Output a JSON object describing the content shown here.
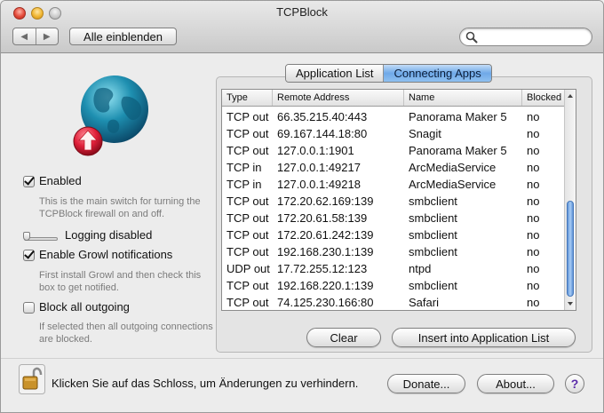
{
  "window": {
    "title": "TCPBlock"
  },
  "toolbar": {
    "back_icon": "chevron-left-icon",
    "forward_icon": "chevron-right-icon",
    "show_all_label": "Alle einblenden",
    "search_placeholder": "",
    "search_icon": "search-icon"
  },
  "options": {
    "enabled": {
      "label": "Enabled",
      "checked": true,
      "help": "This is the main switch for turning the TCPBlock firewall on and off."
    },
    "logging": {
      "label": "Logging disabled",
      "level": 0
    },
    "growl": {
      "label": "Enable Growl notifications",
      "checked": true,
      "help": "First install Growl and then check this box to get notified."
    },
    "block_outgoing": {
      "label": "Block all outgoing",
      "checked": false,
      "help": "If selected then all outgoing connections are blocked."
    }
  },
  "tabs": [
    {
      "label": "Application List",
      "active": false
    },
    {
      "label": "Connecting Apps",
      "active": true
    }
  ],
  "table": {
    "headers": [
      "Type",
      "Remote Address",
      "Name",
      "Blocked"
    ],
    "rows": [
      [
        "TCP out",
        "66.35.215.40:443",
        "Panorama Maker 5",
        "no"
      ],
      [
        "TCP out",
        "69.167.144.18:80",
        "Snagit",
        "no"
      ],
      [
        "TCP out",
        "127.0.0.1:1901",
        "Panorama Maker 5",
        "no"
      ],
      [
        "TCP in",
        "127.0.0.1:49217",
        "ArcMediaService",
        "no"
      ],
      [
        "TCP in",
        "127.0.0.1:49218",
        "ArcMediaService",
        "no"
      ],
      [
        "TCP out",
        "172.20.62.169:139",
        "smbclient",
        "no"
      ],
      [
        "TCP out",
        "172.20.61.58:139",
        "smbclient",
        "no"
      ],
      [
        "TCP out",
        "172.20.61.242:139",
        "smbclient",
        "no"
      ],
      [
        "TCP out",
        "192.168.230.1:139",
        "smbclient",
        "no"
      ],
      [
        "UDP out",
        "17.72.255.12:123",
        "ntpd",
        "no"
      ],
      [
        "TCP out",
        "192.168.220.1:139",
        "smbclient",
        "no"
      ],
      [
        "TCP out",
        "74.125.230.166:80",
        "Safari",
        "no"
      ]
    ]
  },
  "buttons": {
    "clear": "Clear",
    "insert": "Insert into Application List",
    "donate": "Donate...",
    "about": "About...",
    "help": "?"
  },
  "footer": {
    "lock_text": "Klicken Sie auf das Schloss, um Änderungen zu verhindern.",
    "lock_icon": "unlocked-padlock-icon"
  },
  "colors": {
    "accent_tab": "#6fa9e8",
    "globe": "#1e8fb0",
    "badge": "#e0203a"
  }
}
